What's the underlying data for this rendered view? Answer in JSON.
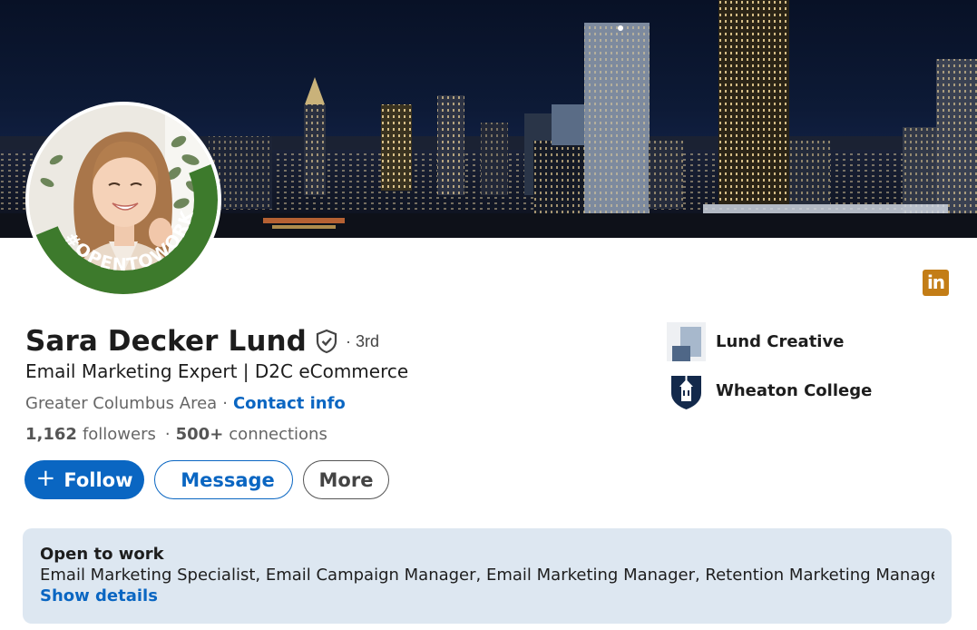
{
  "profile": {
    "name": "Sara Decker Lund",
    "degree": "· 3rd",
    "headline": "Email Marketing Expert | D2C eCommerce",
    "location": "Greater Columbus Area",
    "location_separator": "·",
    "contact_label": "Contact info",
    "followers_count": "1,162",
    "followers_label": "followers",
    "connections_separator": "·",
    "connections_count": "500+",
    "connections_label": "connections",
    "open_to_work_frame_text": "#OPENTOWORK"
  },
  "actions": {
    "follow_label": "Follow",
    "follow_icon": "plus-icon",
    "message_label": "Message",
    "message_icon": "send-icon",
    "more_label": "More"
  },
  "organizations": [
    {
      "name": "Lund Creative",
      "icon": "company-logo"
    },
    {
      "name": "Wheaton College",
      "icon": "school-crest-logo"
    }
  ],
  "open_to_work": {
    "title": "Open to work",
    "roles": "Email Marketing Specialist, Email Campaign Manager, Email Marketing Manager, Retention Marketing Manager and ...",
    "details_label": "Show details"
  },
  "badge": {
    "text": "in",
    "color": "#c37d16"
  },
  "colors": {
    "primary": "#0a66c2",
    "open_to_work_green": "#3d7a2c",
    "card_background": "#dde7f1"
  }
}
